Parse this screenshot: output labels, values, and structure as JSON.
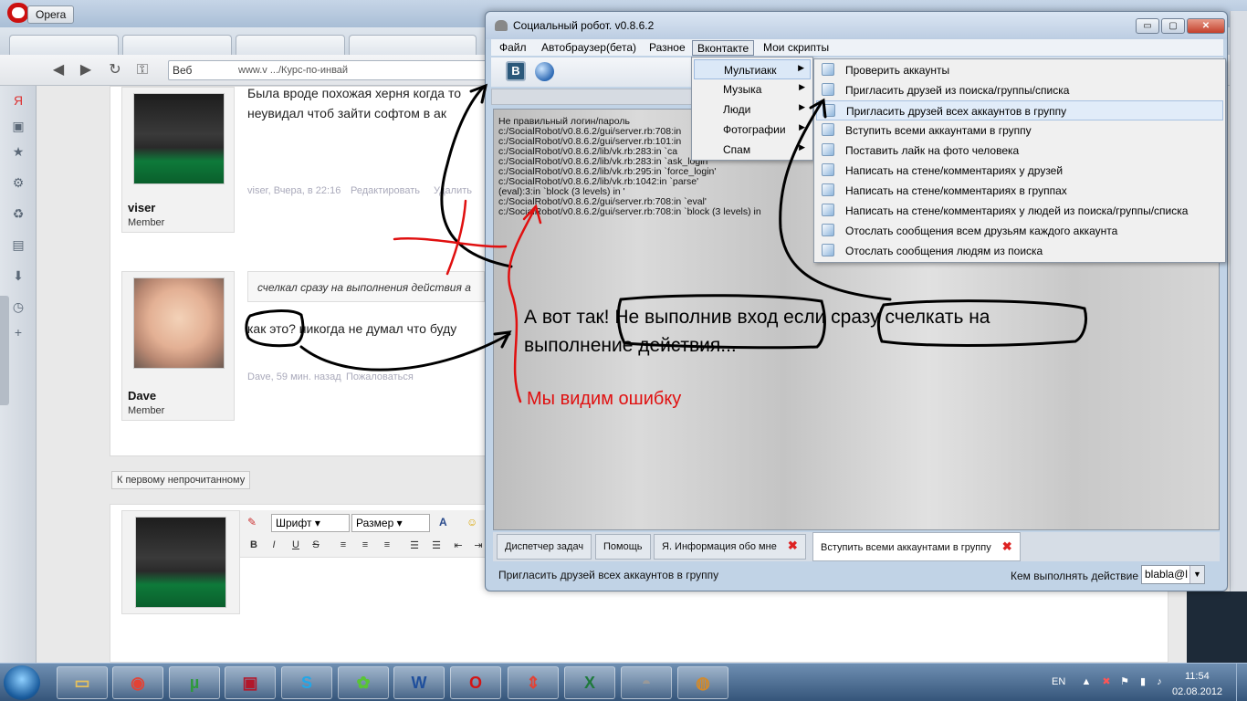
{
  "opera": {
    "menu_label": "Opera",
    "address_web": "Веб",
    "address_url": "www.v                         .../Курс-по-инвай"
  },
  "forum": {
    "post1": {
      "username": "viser",
      "role": "Member",
      "text_line1": "Была вроде похожая херня когда то",
      "text_line2": "неувидал чтоб зайти софтом в ак",
      "meta": "viser, Вчера, в 22:16",
      "edit": "Редактировать",
      "delete": "Удалить"
    },
    "post2": {
      "username": "Dave",
      "role": "Member",
      "quote": "счелкал сразу на выполнения действия а",
      "text": "как это? никогда не думал что буду",
      "meta": "Dave, 59 мин. назад",
      "complain": "Пожаловаться"
    },
    "first_unread": "К первому непрочитанному",
    "editor": {
      "font_select": "Шрифт",
      "size_select": "Размер",
      "bold": "B",
      "italic": "I",
      "underline": "U",
      "strike": "S"
    }
  },
  "robot": {
    "title": "Социальный робот. v0.8.6.2",
    "min": "▭",
    "max": "▢",
    "close": "✕",
    "menu": {
      "file": "Файл",
      "autobrowser": "Автобраузер(бета)",
      "misc": "Разное",
      "vk": "Вконтакте",
      "scripts": "Мои скрипты"
    },
    "vk_button": "B",
    "log": [
      "Не правильный логин/пароль",
      "c:/SocialRobot/v0.8.6.2/gui/server.rb:708:in",
      "c:/SocialRobot/v0.8.6.2/gui/server.rb:101:in",
      "c:/SocialRobot/v0.8.6.2/lib/vk.rb:283:in `ca",
      "c:/SocialRobot/v0.8.6.2/lib/vk.rb:283:in `ask_login'",
      "c:/SocialRobot/v0.8.6.2/lib/vk.rb:295:in `force_login'",
      "c:/SocialRobot/v0.8.6.2/lib/vk.rb:1042:in `parse'",
      "(eval):3:in `block (3 levels) in '",
      "c:/SocialRobot/v0.8.6.2/gui/server.rb:708:in `eval'",
      "c:/SocialRobot/v0.8.6.2/gui/server.rb:708:in `block (3 levels) in"
    ],
    "annotation_black_line1": "А вот так! Не выполнив вход если сразу счелкать на",
    "annotation_black_line2": "выполнение действия...",
    "annotation_red": "Мы видим ошибку",
    "tabs": [
      "Диспетчер задач",
      "Помощь",
      "Я. Информация обо мне",
      "Вступить всеми аккаунтами в группу"
    ],
    "status_text": "Пригласить друзей всех аккаунтов в группу",
    "status_label": "Кем выполнять действие",
    "status_value": "blabla@l"
  },
  "vk_menu": {
    "items": [
      "Мультиакк",
      "Музыка",
      "Люди",
      "Фотографии",
      "Спам"
    ]
  },
  "submenu": {
    "items": [
      "Проверить аккаунты",
      "Пригласить друзей из поиска/группы/списка",
      "Пригласить друзей всех аккаунтов в группу",
      "Вступить всеми аккаунтами в группу",
      "Поставить лайк на фото человека",
      "Написать на стене/комментариях у друзей",
      "Написать на стене/комментариях в группах",
      "Написать на стене/комментариях у людей из поиска/группы/списка",
      "Отослать сообщения всем друзьям каждого аккаунта",
      "Отослать сообщения людям из поиска"
    ],
    "highlighted_index": 2
  },
  "taskbar": {
    "lang": "EN",
    "time": "11:54",
    "date": "02.08.2012"
  },
  "colors": {
    "annotation_red": "#e01010",
    "menu_highlight": "#dbe8f7"
  }
}
